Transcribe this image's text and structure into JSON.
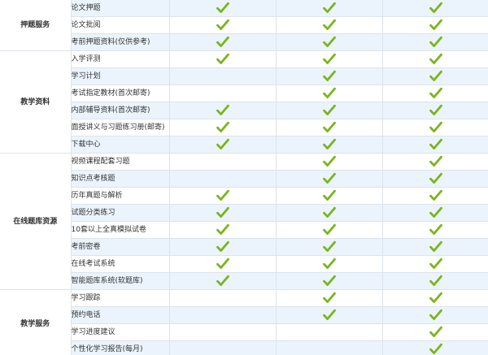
{
  "colors": {
    "check": "#7ab51d",
    "alt_row": "#ebf4fc",
    "border": "#dde3ea",
    "text": "#333333"
  },
  "icon": "check-icon",
  "groups": [
    {
      "title": "押题服务",
      "rows": [
        {
          "label": "论文押题",
          "marks": [
            true,
            true,
            true
          ]
        },
        {
          "label": "论文批阅",
          "marks": [
            true,
            true,
            true
          ]
        },
        {
          "label": "考前押题资料(仅供参考)",
          "marks": [
            true,
            true,
            true
          ]
        }
      ]
    },
    {
      "title": "教学资料",
      "rows": [
        {
          "label": "入学评测",
          "marks": [
            true,
            true,
            true
          ]
        },
        {
          "label": "学习计划",
          "marks": [
            false,
            true,
            true
          ]
        },
        {
          "label": "考试指定教材(首次邮寄)",
          "marks": [
            false,
            true,
            true
          ]
        },
        {
          "label": "内部辅导资料(首次邮寄)",
          "marks": [
            true,
            true,
            true
          ]
        },
        {
          "label": "面授讲义与习题练习册(邮寄)",
          "marks": [
            true,
            true,
            true
          ]
        },
        {
          "label": "下载中心",
          "marks": [
            true,
            true,
            true
          ]
        }
      ]
    },
    {
      "title": "在线题库资源",
      "rows": [
        {
          "label": "视频课程配套习题",
          "marks": [
            false,
            true,
            true
          ]
        },
        {
          "label": "知识点考核题",
          "marks": [
            false,
            true,
            true
          ]
        },
        {
          "label": "历年真题与解析",
          "marks": [
            true,
            true,
            true
          ]
        },
        {
          "label": "试题分类练习",
          "marks": [
            true,
            true,
            true
          ]
        },
        {
          "label": "10套以上全真模拟试卷",
          "marks": [
            true,
            true,
            true
          ]
        },
        {
          "label": "考前密卷",
          "marks": [
            true,
            true,
            true
          ]
        },
        {
          "label": "在线考试系统",
          "marks": [
            true,
            true,
            true
          ]
        },
        {
          "label": "智能题库系统(软题库)",
          "marks": [
            true,
            true,
            true
          ]
        }
      ]
    },
    {
      "title": "教学服务",
      "rows": [
        {
          "label": "学习跟踪",
          "marks": [
            false,
            true,
            true
          ]
        },
        {
          "label": "预约电话",
          "marks": [
            false,
            true,
            true
          ]
        },
        {
          "label": "学习进度建议",
          "marks": [
            false,
            false,
            true
          ]
        },
        {
          "label": "个性化学习报告(每月)",
          "marks": [
            false,
            false,
            true
          ]
        }
      ]
    }
  ]
}
